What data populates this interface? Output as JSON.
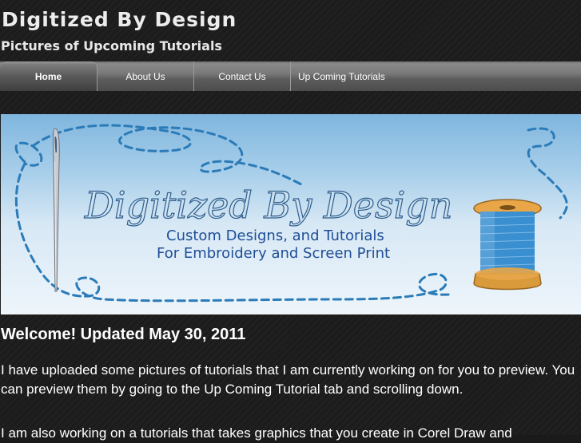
{
  "header": {
    "site_title": "Digitized By Design",
    "site_subtitle": "Pictures of Upcoming Tutorials"
  },
  "nav": {
    "items": [
      {
        "label": "Home",
        "active": true
      },
      {
        "label": "About Us",
        "active": false
      },
      {
        "label": "Contact Us",
        "active": false
      },
      {
        "label": "Up Coming Tutorials",
        "active": false
      }
    ]
  },
  "banner": {
    "title": "Digitized By Design",
    "tagline_line1": "Custom Designs, and Tutorials",
    "tagline_line2": "For Embroidery and Screen Print",
    "icons": [
      "needle-icon",
      "thread-spool-icon"
    ],
    "colors": {
      "thread": "#2a7bb8",
      "sky": "#8fc1e4",
      "spool_wood": "#d89a3a",
      "title": "#2e5e8c"
    }
  },
  "content": {
    "heading": "Welcome!  Updated May 30, 2011",
    "paragraph1": "I have uploaded some pictures of tutorials that I am currently working on for you to preview.  You can preview them by going to the Up Coming Tutorial tab and scrolling down.",
    "paragraph2": "I am also working on a tutorials that takes graphics that you create in Corel Draw and"
  }
}
